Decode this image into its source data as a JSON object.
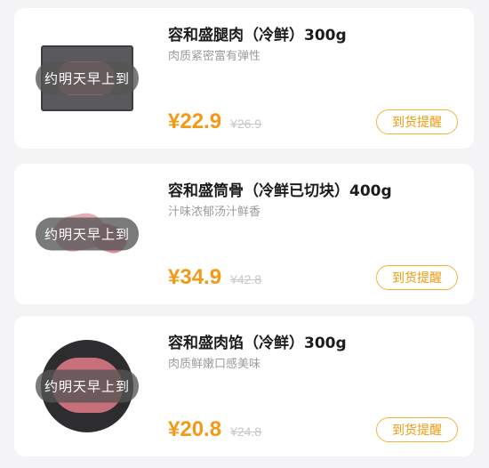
{
  "products": [
    {
      "title": "容和盛腿肉（冷鲜）300g",
      "desc": "肉质紧密富有弹性",
      "tag": "约明天早上到",
      "price": "¥22.9",
      "old_price": "¥26.9",
      "button": "到货提醒"
    },
    {
      "title": "容和盛筒骨（冷鲜已切块）400g",
      "desc": "汁味浓郁汤汁鲜香",
      "tag": "约明天早上到",
      "price": "¥34.9",
      "old_price": "¥42.8",
      "button": "到货提醒"
    },
    {
      "title": "容和盛肉馅（冷鲜）300g",
      "desc": "肉质鲜嫩口感美味",
      "tag": "约明天早上到",
      "price": "¥20.8",
      "old_price": "¥24.8",
      "button": "到货提醒"
    }
  ],
  "colors": {
    "price": "#f29a17",
    "button_border": "#f2b43a"
  }
}
